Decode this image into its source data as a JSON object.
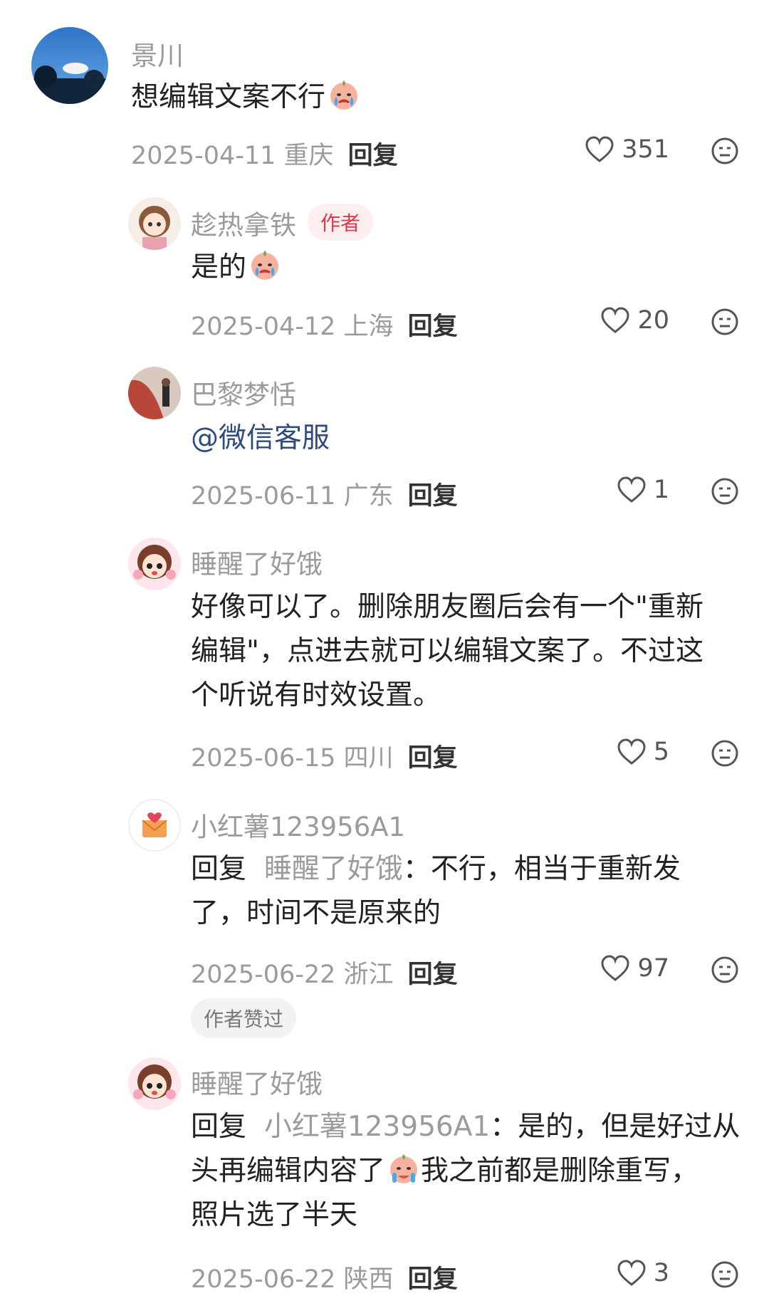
{
  "comments": [
    {
      "user": "景川",
      "text": "想编辑文案不行",
      "date": "2025-04-11",
      "location": "重庆",
      "reply": "回复",
      "likes": "351"
    },
    {
      "user": "趁热拿铁",
      "badge": "作者",
      "text": "是的",
      "date": "2025-04-12",
      "location": "上海",
      "reply": "回复",
      "likes": "20"
    },
    {
      "user": "巴黎梦恬",
      "text": "@微信客服",
      "date": "2025-06-11",
      "location": "广东",
      "reply": "回复",
      "likes": "1"
    },
    {
      "user": "睡醒了好饿",
      "text_lines": [
        "好像可以了。删除朋友圈后会有一个\"重新",
        "编辑\"，点进去就可以编辑文案了。不过这",
        "个听说有时效设置。"
      ],
      "date": "2025-06-15",
      "location": "四川",
      "reply": "回复",
      "likes": "5"
    },
    {
      "user": "小红薯123956A1",
      "reply_prefix": "回复",
      "reply_to": "睡醒了好饿",
      "text_lines": [
        "：不行，相当于重新发",
        "了，时间不是原来的"
      ],
      "date": "2025-06-22",
      "location": "浙江",
      "reply": "回复",
      "likes": "97",
      "chip": "作者赞过"
    },
    {
      "user": "睡醒了好饿",
      "reply_prefix": "回复",
      "reply_to": "小红薯123956A1",
      "text_lines": [
        "：是的，但是好过从",
        "头再编辑内容了",
        "我之前都是删除重写，",
        "照片选了半天"
      ],
      "date": "2025-06-22",
      "location": "陕西",
      "reply": "回复",
      "likes": "3"
    }
  ]
}
